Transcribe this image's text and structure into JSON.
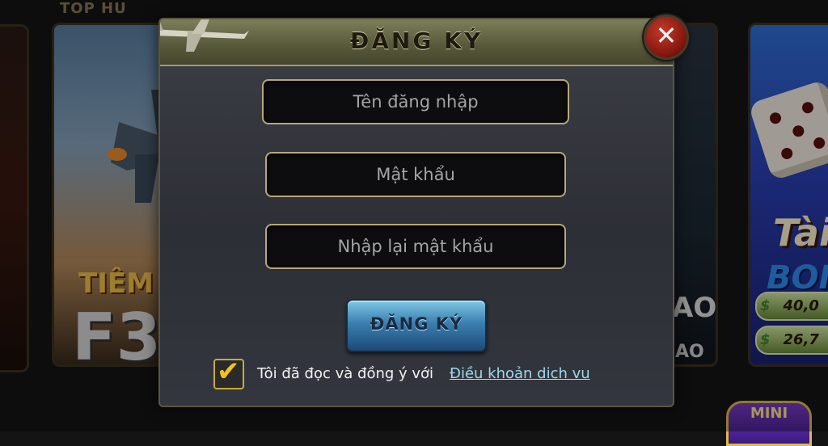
{
  "background": {
    "top_label": "TOP HU",
    "games": [
      {
        "line1": "TIÊM",
        "line2": "F3"
      },
      {
        "line1": "AO",
        "line2": "AO"
      },
      {
        "line1": "Tài",
        "line2": "BOI"
      }
    ],
    "jackpots": [
      "40,0",
      "26,7"
    ],
    "mini_badge": "MINI"
  },
  "modal": {
    "title": "ĐĂNG KÝ",
    "username_placeholder": "Tên đăng nhập",
    "password_placeholder": "Mật khẩu",
    "confirm_password_placeholder": "Nhập lại mật khẩu",
    "submit_label": "ĐĂNG KÝ",
    "agree_text": "Tôi đã đọc và đồng ý với",
    "terms_link": "Điều khoản dich vu",
    "agree_checked": true,
    "close_symbol": "✕"
  },
  "icons": {
    "close": "close-icon",
    "checkmark": "checkmark-icon",
    "airplane": "airplane-icon",
    "dice": "dice-icon"
  },
  "colors": {
    "header": "#5a5b3c",
    "field_border": "#b9a777",
    "button": "#3a7fb0",
    "checkbox": "#f2c417",
    "link": "#9fd8ee",
    "close": "#8a1a10"
  }
}
